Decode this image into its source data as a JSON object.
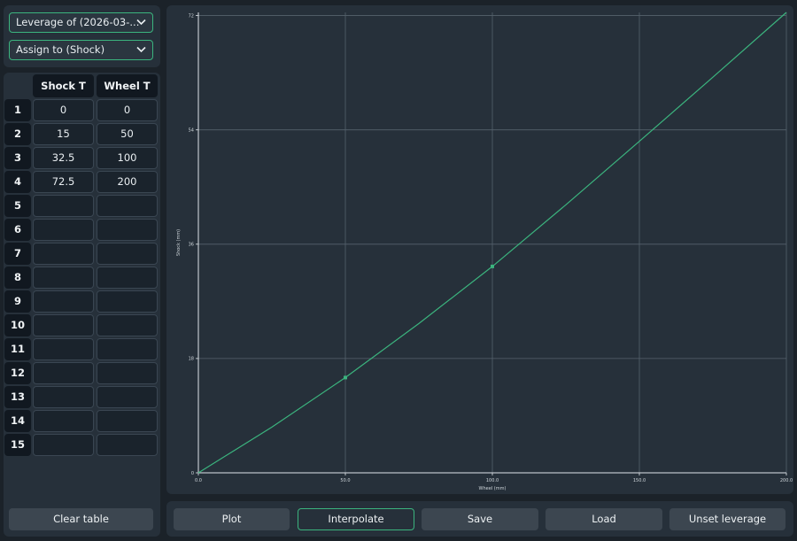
{
  "dropdowns": {
    "leverage": "Leverage of (2026-03-...",
    "assign": "Assign to (Shock)"
  },
  "table": {
    "headers": [
      "Shock T",
      "Wheel T"
    ],
    "rows": [
      {
        "num": "1",
        "shock": "0",
        "wheel": "0"
      },
      {
        "num": "2",
        "shock": "15",
        "wheel": "50"
      },
      {
        "num": "3",
        "shock": "32.5",
        "wheel": "100"
      },
      {
        "num": "4",
        "shock": "72.5",
        "wheel": "200"
      },
      {
        "num": "5",
        "shock": "",
        "wheel": ""
      },
      {
        "num": "6",
        "shock": "",
        "wheel": ""
      },
      {
        "num": "7",
        "shock": "",
        "wheel": ""
      },
      {
        "num": "8",
        "shock": "",
        "wheel": ""
      },
      {
        "num": "9",
        "shock": "",
        "wheel": ""
      },
      {
        "num": "10",
        "shock": "",
        "wheel": ""
      },
      {
        "num": "11",
        "shock": "",
        "wheel": ""
      },
      {
        "num": "12",
        "shock": "",
        "wheel": ""
      },
      {
        "num": "13",
        "shock": "",
        "wheel": ""
      },
      {
        "num": "14",
        "shock": "",
        "wheel": ""
      },
      {
        "num": "15",
        "shock": "",
        "wheel": ""
      }
    ]
  },
  "buttons": {
    "clear_table": "Clear table",
    "plot": "Plot",
    "interpolate": "Interpolate",
    "save": "Save",
    "load": "Load",
    "unset_leverage": "Unset leverage"
  },
  "colors": {
    "accent": "#3bb47e",
    "background": "#1b2229",
    "panel": "#26303a"
  },
  "icons": {
    "dropdown": "chevron-down-icon"
  },
  "chart_data": {
    "type": "line",
    "title": "",
    "xlabel": "Wheel (mm)",
    "ylabel": "Shock (mm)",
    "xlim": [
      0,
      200
    ],
    "ylim": [
      0,
      72.5
    ],
    "x_ticks": [
      "0.0",
      "50.0",
      "100.0",
      "150.0",
      "200.0"
    ],
    "y_ticks": [
      "0",
      "18",
      "36",
      "54",
      "72"
    ],
    "grid": true,
    "series": [
      {
        "color": "#3bb47e",
        "x": [
          0,
          25,
          50,
          75,
          100,
          125,
          150,
          175,
          200
        ],
        "y": [
          0,
          7.2,
          15,
          23.5,
          32.5,
          42.2,
          52.2,
          62.3,
          72.5
        ]
      }
    ],
    "points": [
      {
        "x": 50,
        "y": 15
      },
      {
        "x": 100,
        "y": 32.5
      }
    ]
  }
}
